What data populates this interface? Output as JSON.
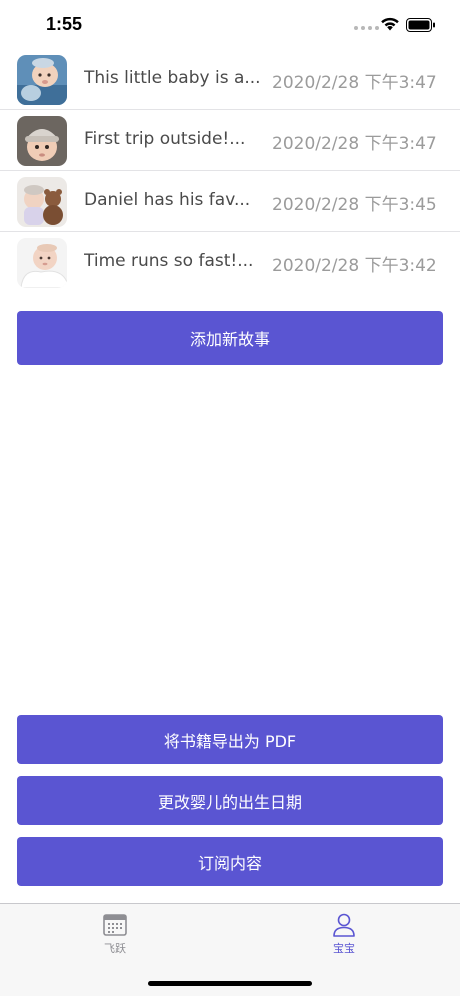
{
  "status_bar": {
    "time": "1:55",
    "icons": [
      "signal-dots-icon",
      "wifi-icon",
      "battery-icon"
    ]
  },
  "stories": [
    {
      "title": "This little baby is a...",
      "date": "2020/2/28 下午3:47",
      "thumbnail": "baby-photo-icon"
    },
    {
      "title": "First trip outside!...",
      "date": "2020/2/28 下午3:47",
      "thumbnail": "baby-hat-photo-icon"
    },
    {
      "title": "Daniel has his fav...",
      "date": "2020/2/28 下午3:45",
      "thumbnail": "baby-teddy-photo-icon"
    },
    {
      "title": "Time runs so fast!...",
      "date": "2020/2/28 下午3:42",
      "thumbnail": "newborn-photo-icon"
    }
  ],
  "actions": {
    "add_story": "添加新故事",
    "export_pdf": "将书籍导出为 PDF",
    "change_birthdate": "更改婴儿的出生日期",
    "subscribe": "订阅内容"
  },
  "tab_bar": {
    "tabs": [
      {
        "label": "飞跃",
        "icon": "calendar-icon",
        "selected": false
      },
      {
        "label": "宝宝",
        "icon": "person-icon",
        "selected": true
      }
    ]
  },
  "colors": {
    "accent": "#5a55d2",
    "date_text": "#9b9b9b",
    "title_text": "#4a4a4a",
    "tab_inactive": "#8e8e93"
  }
}
